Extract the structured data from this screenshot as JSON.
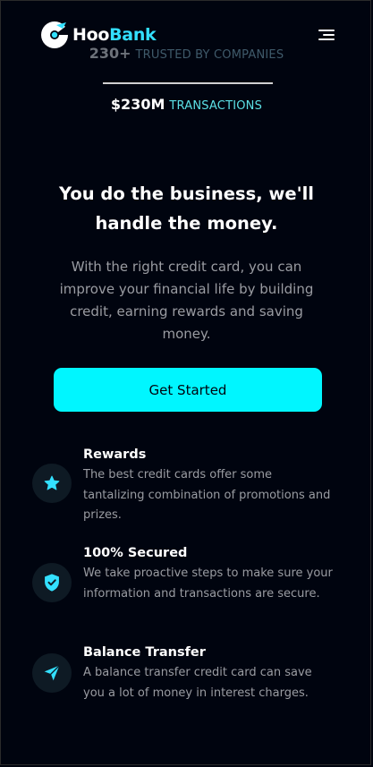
{
  "stats": [
    {
      "value": "230+",
      "label": "TRUSTED BY COMPANIES"
    },
    {
      "value": "$230M",
      "label": "TRANSACTIONS"
    }
  ],
  "navbar": {
    "logo_part_a": "Hoo",
    "logo_part_b": "Bank",
    "menu_icon": "hamburger-menu-icon"
  },
  "hero": {
    "title": "You do the business, we'll handle the money.",
    "text": "With the right credit card, you can improve your financial life by building credit, earning rewards and saving money.",
    "cta_label": "Get Started"
  },
  "features": [
    {
      "title": "Rewards",
      "text": "The best credit cards offer some tantalizing combination of promotions and prizes.",
      "icon": "star-icon"
    },
    {
      "title": "100% Secured",
      "text": "We take proactive steps to make sure your information and transactions are secure.",
      "icon": "shield-icon"
    },
    {
      "title": "Balance Transfer",
      "text": "A balance transfer credit card can save you a lot of money in interest charges.",
      "icon": "send-icon"
    }
  ],
  "colors": {
    "background": "#00040f",
    "accent": "#00f6ff",
    "accent_text": "#5ce1e6",
    "muted_text": "#9a9ca2",
    "icon_bg": "#0e1a24"
  }
}
